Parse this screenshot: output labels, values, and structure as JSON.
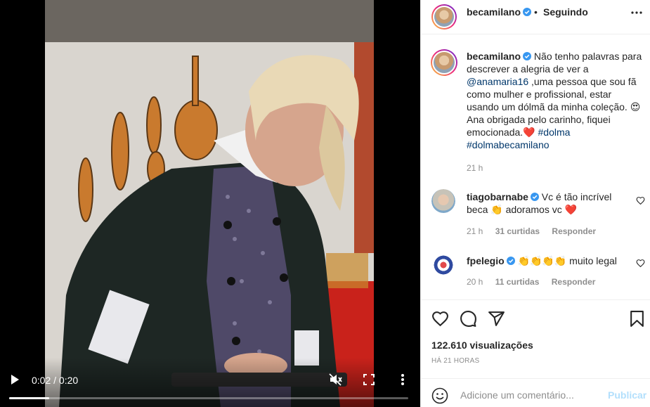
{
  "video": {
    "time_label": "0:02 / 0:20",
    "progress": 0.1,
    "icons": [
      "play-icon",
      "mute-icon",
      "fullscreen-icon",
      "more-vertical-icon"
    ]
  },
  "header": {
    "username": "becamilano",
    "separator": "•",
    "follow_status": "Seguindo"
  },
  "caption": {
    "username": "becamilano",
    "text_1": "Não tenho palavras para descrever a alegria de ver a",
    "mention": "@anamaria16",
    "text_2": ",uma pessoa que sou fã como mulher e profissional, estar usando um dólmã da minha coleção. 😍 Ana obrigada pelo carinho, fiquei emocionada.❤️",
    "hashtag_1": "#dolma",
    "hashtag_2": "#dolmabecamilano",
    "time": "21 h"
  },
  "comments": [
    {
      "username": "tiagobarnabe",
      "text": "Vc é tão incrível beca 👏 adoramos vc ❤️",
      "time": "21 h",
      "likes": "31 curtidas",
      "reply": "Responder"
    },
    {
      "username": "fpelegio",
      "text": "👏👏👏👏 muito legal",
      "time": "20 h",
      "likes": "11 curtidas",
      "reply": "Responder"
    }
  ],
  "stats": {
    "views": "122.610 visualizações",
    "posted": "HÁ 21 HORAS"
  },
  "add_comment": {
    "placeholder": "Adicione um comentário...",
    "publish": "Publicar"
  },
  "colors": {
    "verified": "#3897f0",
    "link": "#00376b",
    "muted": "#8e8e8e",
    "publish_disabled": "#b2dffc"
  }
}
